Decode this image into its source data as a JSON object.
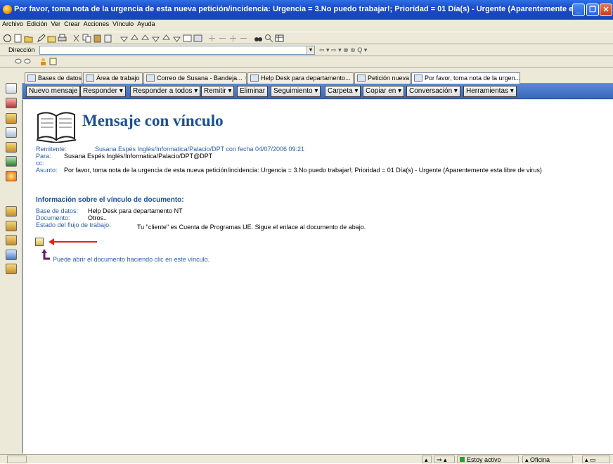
{
  "window": {
    "title": "Por favor, toma nota de la urgencia de esta nueva petición/incidencia: Urgencia = 3.No puedo trabajar!; Prioridad = 01 Día(s) - Urgente    (Aparentemente esta libre de...",
    "minimize": "_",
    "maximize": "❐",
    "close": "✕"
  },
  "menu": [
    "Archivo",
    "Edición",
    "Ver",
    "Crear",
    "Acciones",
    "Vínculo",
    "Ayuda"
  ],
  "address": {
    "label": "Dirección",
    "value": "",
    "nav": "⇦ ▾ ⇨ ▾ ⊗ ⊛ Q ▾"
  },
  "tabs": [
    {
      "label": "Bases de datos"
    },
    {
      "label": "Área de trabajo",
      "close": "✕"
    },
    {
      "label": "Correo de Susana - Bandeja...",
      "close": "✕"
    },
    {
      "label": "Help Desk para departamento...",
      "close": "✕"
    },
    {
      "label": "Petición nueva",
      "close": "✕"
    },
    {
      "label": "Por favor, toma nota de la urgen...",
      "close": "✕"
    }
  ],
  "actions": [
    "Nuevo mensaje",
    "Responder ▾",
    "Responder a todos ▾",
    "Remitir ▾",
    "Eliminar",
    "Seguimiento ▾",
    "Carpeta ▾",
    "Copiar en ▾",
    "Conversación ▾",
    "Herramientas ▾"
  ],
  "message": {
    "heading": "Mensaje con vínculo",
    "remitente_label": "Remitente:",
    "remitente": "Susana Espés Inglés/Informatica/Palacio/DPT con fecha 04/07/2006 09:21",
    "para_label": "Para:",
    "para": "Susana Espés Inglés/Informatica/Palacio/DPT@DPT",
    "cc_label": "cc:",
    "asunto_label": "Asunto:",
    "asunto": "Por favor, toma nota de la urgencia de esta nueva petición/incidencia: Urgencia = 3.No puedo trabajar!; Prioridad = 01 Día(s) - Urgente    (Aparentemente esta libre de virus)",
    "section_title": "Información sobre el vínculo de documento:",
    "base_label": "Base de datos:",
    "base": "Help Desk para departamento NT",
    "documento_label": "Documento:",
    "documento": "Otros..",
    "estado_label": "Estado del flujo de trabajo:",
    "estado": "Tu \"cliente\" es  Cuenta de Programas UE.  Sigue el enlace al documento de abajo.",
    "link_text": "Puede abrir el documento haciendo clic en este vínculo."
  },
  "status": {
    "activity": "Estoy activo",
    "location": "Oficina"
  }
}
